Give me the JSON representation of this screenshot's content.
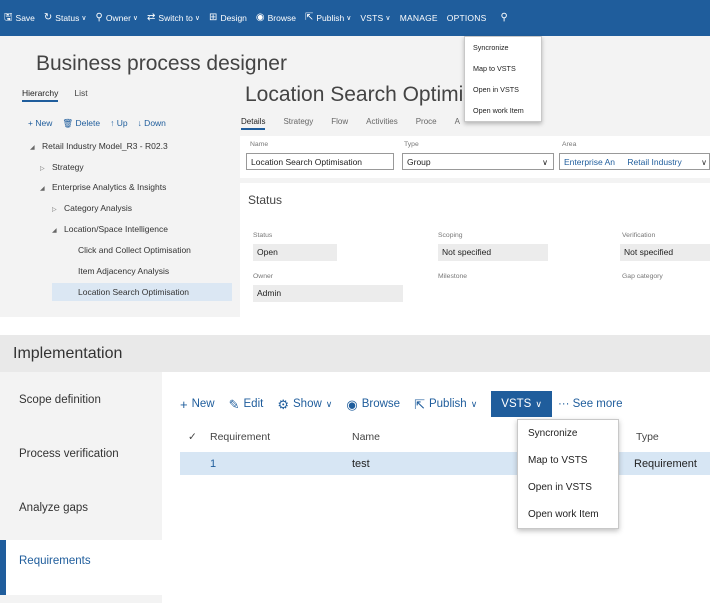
{
  "top": {
    "cmdbar": [
      {
        "icon": "save-icon",
        "glyph": "🖫",
        "label": "Save",
        "chev": false
      },
      {
        "icon": "status-icon",
        "glyph": "↻",
        "label": "Status",
        "chev": true
      },
      {
        "icon": "owner-icon",
        "glyph": "⚲",
        "label": "Owner",
        "chev": true
      },
      {
        "icon": "switch-icon",
        "glyph": "⇄",
        "label": "Switch to",
        "chev": true
      },
      {
        "icon": "design-icon",
        "glyph": "⊞",
        "label": "Design",
        "chev": false
      },
      {
        "icon": "browse-icon",
        "glyph": "◉",
        "label": "Browse",
        "chev": false
      },
      {
        "icon": "publish-icon",
        "glyph": "⇱",
        "label": "Publish",
        "chev": true
      },
      {
        "icon": "",
        "glyph": "",
        "label": "VSTS",
        "chev": true
      },
      {
        "icon": "",
        "glyph": "",
        "label": "MANAGE",
        "chev": false
      },
      {
        "icon": "",
        "glyph": "",
        "label": "OPTIONS",
        "chev": false
      },
      {
        "icon": "search-icon",
        "glyph": "⚲",
        "label": "",
        "chev": false
      }
    ],
    "vsts_menu": [
      "Syncronize",
      "Map to VSTS",
      "Open in VSTS",
      "Open work Item"
    ],
    "page_title": "Business process designer",
    "hier_tabs": [
      "Hierarchy",
      "List"
    ],
    "tree_toolbar": [
      "+ New",
      "🗑 Delete",
      "↑ Up",
      "↓ Down"
    ],
    "tree": [
      {
        "tw": "◢",
        "label": "Retail Industry Model_R3 - R02.3",
        "level": 0
      },
      {
        "tw": "▷",
        "label": "Strategy",
        "level": 1
      },
      {
        "tw": "◢",
        "label": "Enterprise Analytics & Insights",
        "level": 1
      },
      {
        "tw": "▷",
        "label": "Category Analysis",
        "level": 2
      },
      {
        "tw": "◢",
        "label": "Location/Space Intelligence",
        "level": 2
      },
      {
        "tw": "",
        "label": "Click and Collect Optimisation",
        "level": 3
      },
      {
        "tw": "",
        "label": "Item Adjacency Analysis",
        "level": 3
      },
      {
        "tw": "",
        "label": "Location Search Optimisation",
        "level": 3,
        "selected": true
      }
    ],
    "detail_title": "Location Search Optimisatio",
    "form_tabs": [
      "Details",
      "Strategy",
      "Flow",
      "Activities",
      "Proce",
      "A"
    ],
    "fields": {
      "name_label": "Name",
      "name_value": "Location Search Optimisation",
      "type_label": "Type",
      "type_value": "Group",
      "area_label": "Area",
      "area_value1": "Enterprise An",
      "area_value2": "Retail Industry"
    },
    "status_section": {
      "heading": "Status",
      "status_label": "Status",
      "status_value": "Open",
      "scoping_label": "Scoping",
      "scoping_value": "Not specified",
      "verification_label": "Verification",
      "verification_value": "Not specified",
      "owner_label": "Owner",
      "owner_value": "Admin",
      "milestone_label": "Milestone",
      "gap_label": "Gap category"
    }
  },
  "bottom": {
    "title": "Implementation",
    "nav": [
      "Scope definition",
      "Process verification",
      "Analyze gaps",
      "Requirements"
    ],
    "toolbar": [
      {
        "icon": "plus-icon",
        "glyph": "+",
        "label": "New",
        "chev": false
      },
      {
        "icon": "edit-icon",
        "glyph": "✎",
        "label": "Edit",
        "chev": false
      },
      {
        "icon": "show-icon",
        "glyph": "⚙",
        "label": "Show",
        "chev": true
      },
      {
        "icon": "browse-icon",
        "glyph": "◉",
        "label": "Browse",
        "chev": false
      },
      {
        "icon": "publish-icon",
        "glyph": "⇱",
        "label": "Publish",
        "chev": true
      }
    ],
    "vsts_label": "VSTS",
    "see_more": "··· See more",
    "vsts_menu": [
      "Syncronize",
      "Map to VSTS",
      "Open in VSTS",
      "Open work Item"
    ],
    "grid_headers": {
      "check": "✓",
      "requirement": "Requirement",
      "name": "Name",
      "type": "Type"
    },
    "grid_row": {
      "requirement": "1",
      "name": "test",
      "type": "Requirement"
    }
  },
  "colors": {
    "accent": "#1f5d9c",
    "selection": "#d7e6f4"
  }
}
